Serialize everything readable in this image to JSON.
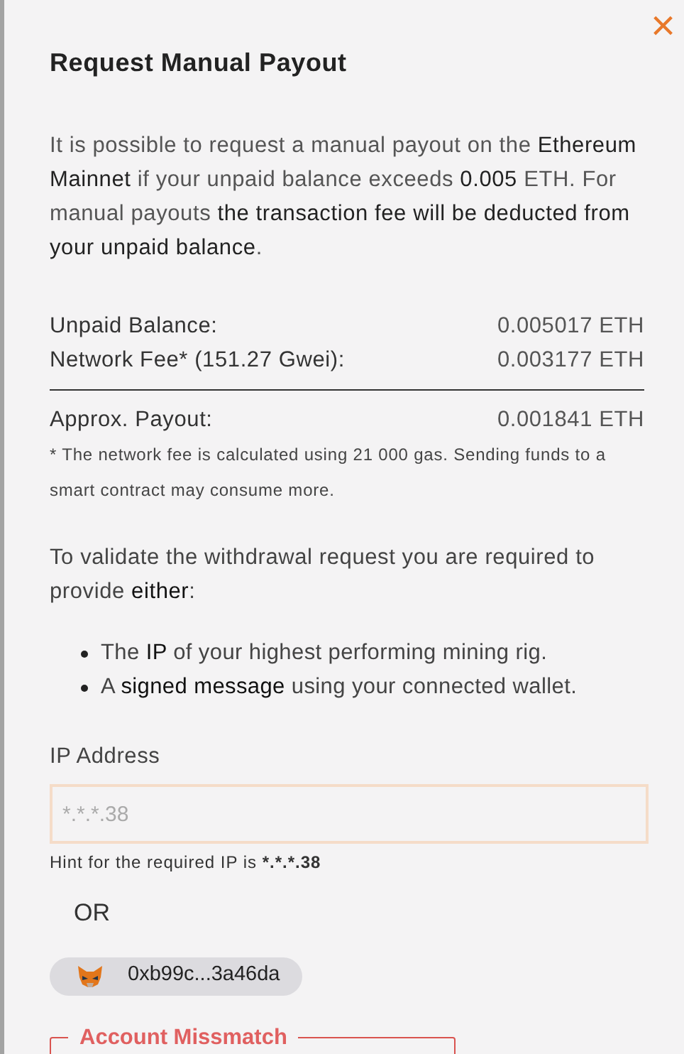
{
  "dialog": {
    "title": "Request Manual Payout",
    "close": "×",
    "intro": "It is possible to request a manual payout on the **Ethereum Mainnet** if your unpaid balance exceeds **0.005** ETH. For manual payouts **the transaction fee will be deducted from your unpaid balance**.",
    "summary": [
      {
        "label": "Unpaid Balance:",
        "value": "0.005017 ETH"
      },
      {
        "label": "Network Fee* (151.27 Gwei):",
        "value": "0.003177 ETH"
      }
    ],
    "total": {
      "label": "Approx. Payout:",
      "value": "0.001841 ETH"
    },
    "footnote": "* The network fee is calculated using 21 000 gas. Sending funds to a smart contract may consume more.",
    "validate_text": "To validate the withdrawal request you are required to provide **either**:",
    "options": [
      "The **IP** of your highest performing mining rig.",
      "A **signed message** using your connected wallet."
    ],
    "ip_field": {
      "label": "IP Address",
      "placeholder": "*.*.*.38"
    },
    "hint": {
      "text": "Hint for the required IP is",
      "value": "*.*.*.38"
    },
    "or": "OR",
    "wallet": {
      "address": "0xb99c...3a46da"
    },
    "warning": {
      "title": "Account Missmatch"
    }
  }
}
